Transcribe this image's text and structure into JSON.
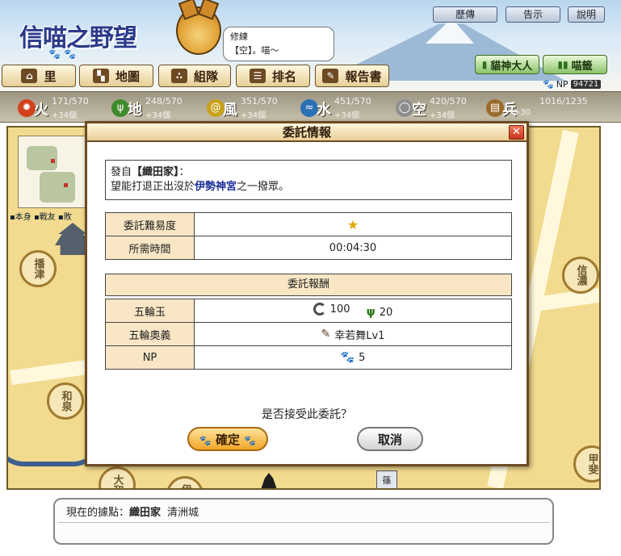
{
  "header": {
    "logo_text": "信喵之野望",
    "logo_subtitle": "",
    "top_buttons": [
      "歷傳",
      "告示",
      "說明"
    ],
    "speech_bubble": {
      "line1": "修練",
      "line2": "【空】。喵～"
    },
    "nav": [
      "里",
      "地圖",
      "組隊",
      "排名",
      "報告書"
    ],
    "green_buttons": [
      "貓神大人",
      "喵籤"
    ],
    "np_label": "NP",
    "np_value": "94721"
  },
  "resources": [
    {
      "name": "火",
      "amount": "171/570",
      "income": "+34個",
      "color": "#d2401c"
    },
    {
      "name": "地",
      "amount": "248/570",
      "income": "+34個",
      "color": "#3f8a2a"
    },
    {
      "name": "風",
      "amount": "351/570",
      "income": "+34個",
      "color": "#c9a21c"
    },
    {
      "name": "水",
      "amount": "451/570",
      "income": "+34個",
      "color": "#2b6fb5"
    },
    {
      "name": "空",
      "amount": "420/570",
      "income": "+34個",
      "color": "#8e8e8e"
    },
    {
      "name": "兵糧",
      "amount": "1016/1235",
      "income": "+30",
      "color": "#9a6a2a"
    }
  ],
  "map": {
    "legend": "▪本身 ▪戰友 ▪敗",
    "provinces": [
      "播津",
      "和泉",
      "大和",
      "伊賀",
      "信濃",
      "甲斐"
    ],
    "tag": "篠"
  },
  "dialog": {
    "title": "委託情報",
    "close": "✕",
    "from_prefix": "發自",
    "from_clan": "【織田家】",
    "from_suffix": "：",
    "request_prefix": "望能打退正出沒於",
    "request_place": "伊勢神宮",
    "request_suffix": "之一撥眾。",
    "difficulty_label": "委託難易度",
    "difficulty_stars": "★",
    "difficulty_level": 1,
    "time_label": "所需時間",
    "time_value": "00:04:30",
    "reward_header": "委託報酬",
    "gorin_label": "五輪玉",
    "gorin_sky_amount": "100",
    "gorin_earth_amount": "20",
    "ougi_label": "五輪奧義",
    "ougi_value": "幸若舞Lv1",
    "np_label": "NP",
    "np_value": "5",
    "question": "是否接受此委託？",
    "ok": "確定",
    "cancel": "取消"
  },
  "status": {
    "prefix": "現在的據點：",
    "clan": "織田家",
    "castle": "清洲城"
  }
}
